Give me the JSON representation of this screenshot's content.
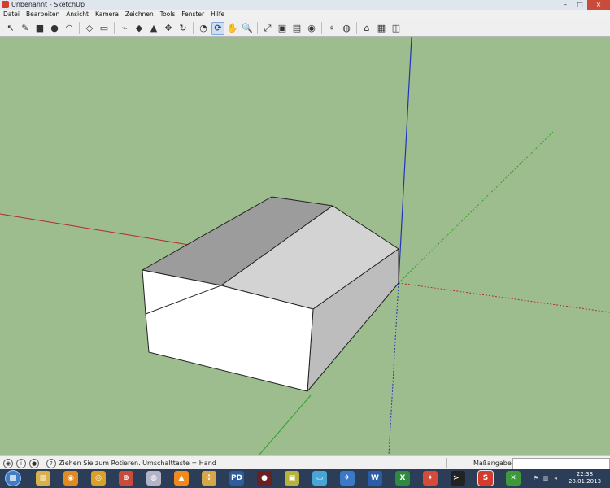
{
  "window": {
    "title": "Unbenannt - SketchUp",
    "controls": {
      "minimize": "–",
      "maximize": "□",
      "close": "×"
    }
  },
  "menu": [
    {
      "label": "Datei"
    },
    {
      "label": "Bearbeiten"
    },
    {
      "label": "Ansicht"
    },
    {
      "label": "Kamera"
    },
    {
      "label": "Zeichnen"
    },
    {
      "label": "Tools"
    },
    {
      "label": "Fenster"
    },
    {
      "label": "Hilfe"
    }
  ],
  "toolbar": {
    "tools": [
      {
        "icon": "select-arrow-icon",
        "glyph": "↖"
      },
      {
        "icon": "pencil-line-icon",
        "glyph": "✎"
      },
      {
        "icon": "rectangle-icon",
        "glyph": "■"
      },
      {
        "icon": "circle-icon",
        "glyph": "●"
      },
      {
        "icon": "arc-icon",
        "glyph": "◠"
      },
      {
        "icon": "make-component-icon",
        "glyph": "◇"
      },
      {
        "icon": "eraser-icon",
        "glyph": "▭"
      },
      {
        "icon": "tape-measure-icon",
        "glyph": "⌁"
      },
      {
        "icon": "paint-bucket-icon",
        "glyph": "◆"
      },
      {
        "icon": "push-pull-icon",
        "glyph": "▲"
      },
      {
        "icon": "move-icon",
        "glyph": "✥"
      },
      {
        "icon": "rotate-icon",
        "glyph": "↻"
      },
      {
        "icon": "offset-icon",
        "glyph": "◔"
      },
      {
        "icon": "orbit-icon",
        "glyph": "⟳"
      },
      {
        "icon": "pan-hand-icon",
        "glyph": "✋"
      },
      {
        "icon": "zoom-icon",
        "glyph": "🔍"
      },
      {
        "icon": "zoom-extents-icon",
        "glyph": "⤢"
      },
      {
        "icon": "get-models-icon",
        "glyph": "▣"
      },
      {
        "icon": "share-model-icon",
        "glyph": "▤"
      },
      {
        "icon": "google-earth-icon",
        "glyph": "◉"
      },
      {
        "icon": "add-location-icon",
        "glyph": "⌖"
      },
      {
        "icon": "toggle-terrain-icon",
        "glyph": "◍"
      },
      {
        "icon": "warehouse-icon",
        "glyph": "⌂"
      },
      {
        "icon": "components-icon",
        "glyph": "▦"
      },
      {
        "icon": "extension-icon",
        "glyph": "◫"
      }
    ],
    "active_index": 13
  },
  "status": {
    "message": "Ziehen Sie zum Rotieren.  Umschalttaste = Hand",
    "measure_label": "Maßangaben",
    "measure_value": ""
  },
  "taskbar": {
    "apps": [
      {
        "icon": "folder-icon",
        "color": "#d9b04a",
        "glyph": "▤"
      },
      {
        "icon": "firefox-icon",
        "color": "#e08a22",
        "glyph": "◉"
      },
      {
        "icon": "burn-icon",
        "color": "#d9a02a",
        "glyph": "◎"
      },
      {
        "icon": "media-icon",
        "color": "#c94b3a",
        "glyph": "⊕"
      },
      {
        "icon": "disc-icon",
        "color": "#b4b4c8",
        "glyph": "◍"
      },
      {
        "icon": "vlc-icon",
        "color": "#f08a1a",
        "glyph": "▲"
      },
      {
        "icon": "gimp-icon",
        "color": "#d6a64a",
        "glyph": "✣"
      },
      {
        "icon": "pd-icon",
        "color": "#2f5c9a",
        "glyph": "PD"
      },
      {
        "icon": "tool-icon",
        "color": "#6a2020",
        "glyph": "●"
      },
      {
        "icon": "archive-icon",
        "color": "#b6b23a",
        "glyph": "▣"
      },
      {
        "icon": "tablet-icon",
        "color": "#48a6d6",
        "glyph": "▭"
      },
      {
        "icon": "plane-icon",
        "color": "#3a78c8",
        "glyph": "✈"
      },
      {
        "icon": "word-icon",
        "color": "#2b5ca8",
        "glyph": "W"
      },
      {
        "icon": "excel-icon",
        "color": "#2e8a3e",
        "glyph": "X"
      },
      {
        "icon": "fox-icon",
        "color": "#d64a3a",
        "glyph": "✦"
      },
      {
        "icon": "terminal-icon",
        "color": "#222222",
        "glyph": ">_"
      },
      {
        "icon": "sketchup-icon",
        "color": "#d53b2a",
        "glyph": "S"
      },
      {
        "icon": "xbox-icon",
        "color": "#3c9a3a",
        "glyph": "✕"
      }
    ],
    "active_app_index": 16,
    "clock": {
      "time": "22:38",
      "date": "28.01.2013"
    }
  },
  "colors": {
    "viewport_bg": "#9dbd8e",
    "red_axis": "#b22a2a",
    "green_axis": "#2ea02a",
    "blue_axis": "#2233bb",
    "face_light": "#d3d3d3",
    "face_gable": "#ffffff",
    "face_dark": "#bdbdbd"
  }
}
